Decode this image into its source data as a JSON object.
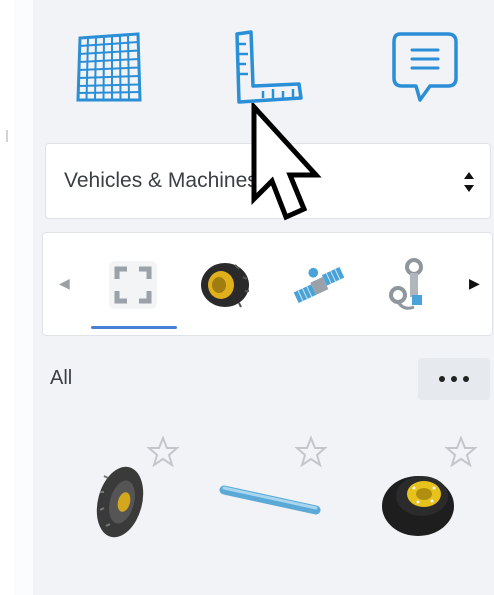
{
  "toolbar": {
    "tools": [
      {
        "name": "grid",
        "icon": "grid-icon"
      },
      {
        "name": "ruler",
        "icon": "ruler-icon"
      },
      {
        "name": "notes",
        "icon": "note-icon"
      }
    ]
  },
  "category_dropdown": {
    "selected": "Vehicles & Machines",
    "icon": "sort-arrows-icon"
  },
  "carousel": {
    "items": [
      {
        "icon": "all-parts-icon",
        "selected": true
      },
      {
        "icon": "wheel-icon",
        "selected": false
      },
      {
        "icon": "satellite-icon",
        "selected": false
      },
      {
        "icon": "hinge-icon",
        "selected": false
      }
    ],
    "prev_icon": "chevron-left-icon",
    "next_icon": "chevron-right-icon"
  },
  "section": {
    "label": "All",
    "more_icon": "more-horizontal-icon"
  },
  "parts": [
    {
      "icon": "tire-icon",
      "favorite_icon": "star-outline-icon"
    },
    {
      "icon": "axle-rod-icon",
      "favorite_icon": "star-outline-icon"
    },
    {
      "icon": "wheel-icon",
      "favorite_icon": "star-outline-icon"
    }
  ],
  "colors": {
    "accent": "#2a8fd6",
    "selected_underline": "#4a7fd4",
    "panel_bg": "#f1f3f6"
  }
}
